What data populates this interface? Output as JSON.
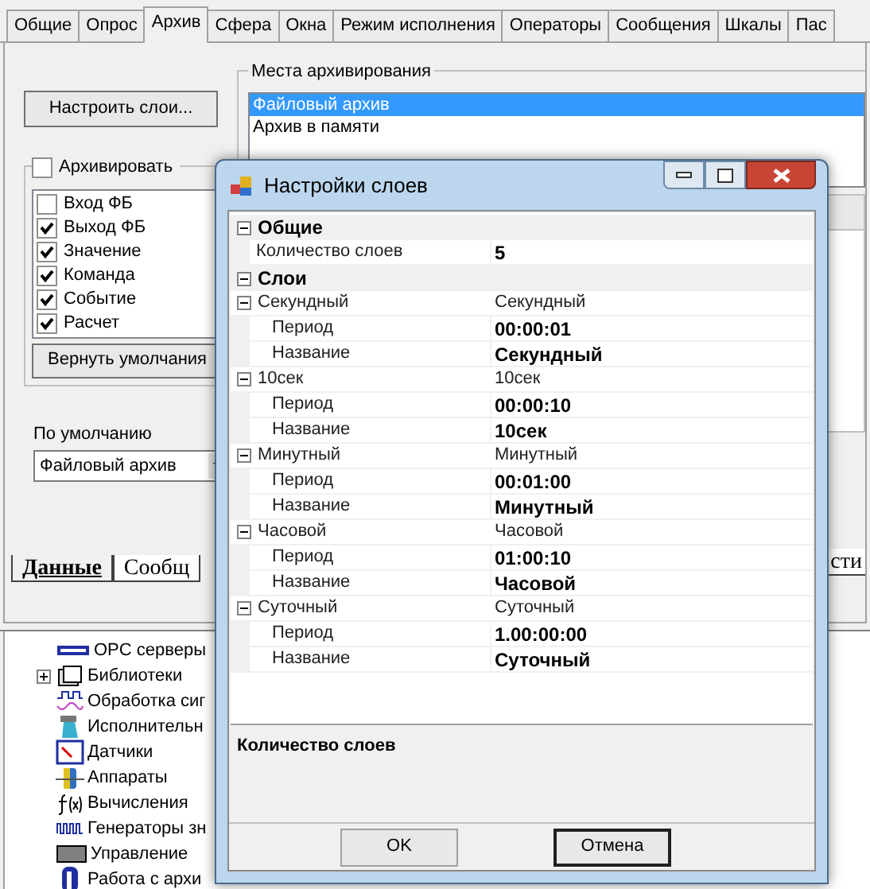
{
  "tabs": [
    {
      "label": "Общие",
      "selected": false
    },
    {
      "label": "Опрос",
      "selected": false
    },
    {
      "label": "Архив",
      "selected": true
    },
    {
      "label": "Сфера",
      "selected": false
    },
    {
      "label": "Окна",
      "selected": false
    },
    {
      "label": "Режим исполнения",
      "selected": false
    },
    {
      "label": "Операторы",
      "selected": false
    },
    {
      "label": "Сообщения",
      "selected": false
    },
    {
      "label": "Шкалы",
      "selected": false
    },
    {
      "label": "Пас",
      "selected": false
    }
  ],
  "setup_button": "Настроить слои...",
  "archive_group": {
    "label": "Архивировать",
    "checked": false,
    "items": [
      {
        "label": "Вход ФБ",
        "checked": false
      },
      {
        "label": "Выход ФБ",
        "checked": true
      },
      {
        "label": "Значение",
        "checked": true
      },
      {
        "label": "Команда",
        "checked": true
      },
      {
        "label": "Событие",
        "checked": true
      },
      {
        "label": "Расчет",
        "checked": true
      }
    ],
    "reset_button": "Вернуть умолчания"
  },
  "default_archive": {
    "label": "По умолчанию",
    "value": "Файловый архив"
  },
  "places": {
    "title": "Места архивирования",
    "items": [
      {
        "label": "Файловый архив",
        "selected": true
      },
      {
        "label": "Архив в памяти",
        "selected": false
      }
    ]
  },
  "bottom_tabs": [
    {
      "label": "Данные",
      "selected": true
    },
    {
      "label": "Сообщ",
      "selected": false
    },
    {
      "label": "сти",
      "selected": false
    }
  ],
  "tree": [
    {
      "label": "OPC серверы",
      "collapsed": false
    },
    {
      "label": "Библиотеки",
      "collapsed": true
    },
    {
      "label": "Обработка сиг",
      "collapsed": false
    },
    {
      "label": "Исполнительн",
      "collapsed": false
    },
    {
      "label": "Датчики",
      "collapsed": false
    },
    {
      "label": "Аппараты",
      "collapsed": false
    },
    {
      "label": "Вычисления",
      "collapsed": false
    },
    {
      "label": "Генераторы зн",
      "collapsed": false
    },
    {
      "label": "Управление",
      "collapsed": false
    },
    {
      "label": "Работа с архи",
      "collapsed": false
    }
  ],
  "dialog": {
    "title": "Настройки слоев",
    "grid": [
      {
        "kind": "category",
        "label": "Общие",
        "expanded": true,
        "children": [
          {
            "kind": "property",
            "label": "Количество слоев",
            "value": "5"
          }
        ]
      },
      {
        "kind": "category",
        "label": "Слои",
        "expanded": true,
        "children": [
          {
            "kind": "group",
            "label": "Секундный",
            "value": "Секундный",
            "expanded": true,
            "children": [
              {
                "kind": "property",
                "label": "Период",
                "value": "00:00:01"
              },
              {
                "kind": "property",
                "label": "Название",
                "value": "Секундный"
              }
            ]
          },
          {
            "kind": "group",
            "label": "10сек",
            "value": "10сек",
            "expanded": true,
            "children": [
              {
                "kind": "property",
                "label": "Период",
                "value": "00:00:10"
              },
              {
                "kind": "property",
                "label": "Название",
                "value": "10сек"
              }
            ]
          },
          {
            "kind": "group",
            "label": "Минутный",
            "value": "Минутный",
            "expanded": true,
            "children": [
              {
                "kind": "property",
                "label": "Период",
                "value": "00:01:00"
              },
              {
                "kind": "property",
                "label": "Название",
                "value": "Минутный"
              }
            ]
          },
          {
            "kind": "group",
            "label": "Часовой",
            "value": "Часовой",
            "expanded": true,
            "children": [
              {
                "kind": "property",
                "label": "Период",
                "value": "01:00:10"
              },
              {
                "kind": "property",
                "label": "Название",
                "value": "Часовой"
              }
            ]
          },
          {
            "kind": "group",
            "label": "Суточный",
            "value": "Суточный",
            "expanded": true,
            "children": [
              {
                "kind": "property",
                "label": "Период",
                "value": "1.00:00:00"
              },
              {
                "kind": "property",
                "label": "Название",
                "value": "Суточный"
              }
            ]
          }
        ]
      }
    ],
    "description": "Количество слоев",
    "buttons": [
      {
        "label": "OK",
        "default": false
      },
      {
        "label": "Отмена",
        "default": true
      }
    ]
  }
}
